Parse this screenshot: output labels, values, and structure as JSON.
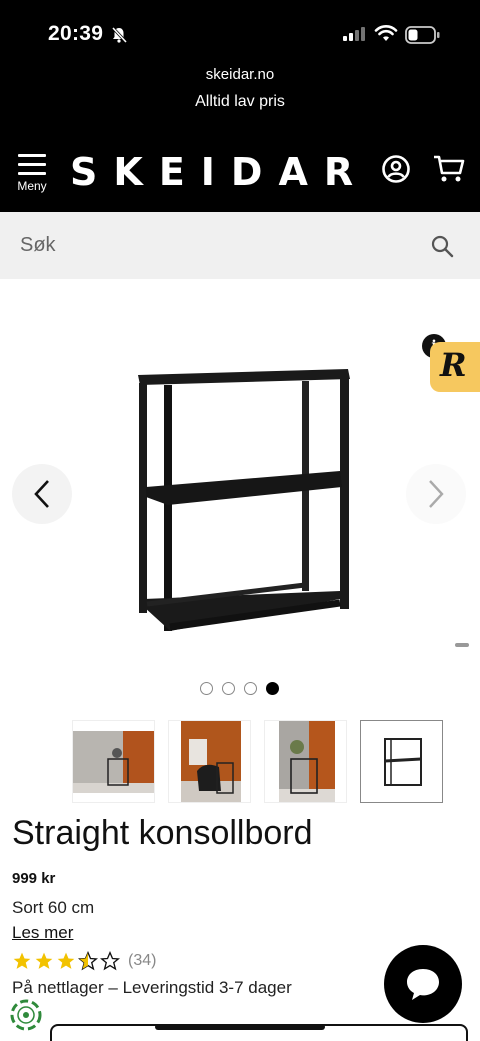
{
  "status_bar": {
    "time": "20:39"
  },
  "promo": {
    "domain": "skeidar.no",
    "tagline": "Alltid lav pris"
  },
  "header": {
    "menu_label": "Meny",
    "logo": "SKEIDAR",
    "icons": [
      "menu-icon",
      "account-icon",
      "cart-icon"
    ]
  },
  "search": {
    "placeholder": "Søk",
    "icon": "search-icon"
  },
  "gallery": {
    "image_count": 4,
    "active_index": 3,
    "thumbnails": [
      "lifestyle-wall",
      "lifestyle-chair",
      "lifestyle-plant",
      "product-black"
    ]
  },
  "product": {
    "title": "Straight konsollbord",
    "price": "999 kr",
    "variant": "Sort 60 cm",
    "read_more": "Les mer",
    "rating": 3.5,
    "rating_max": 5,
    "review_count": "(34)",
    "stock": "På nettlager – Leveringstid 3-7 dager"
  },
  "colors": {
    "header_bg": "#000000",
    "star": "#f2c200",
    "badge": "#f6c85f",
    "search_bg": "#f0f0f0"
  }
}
